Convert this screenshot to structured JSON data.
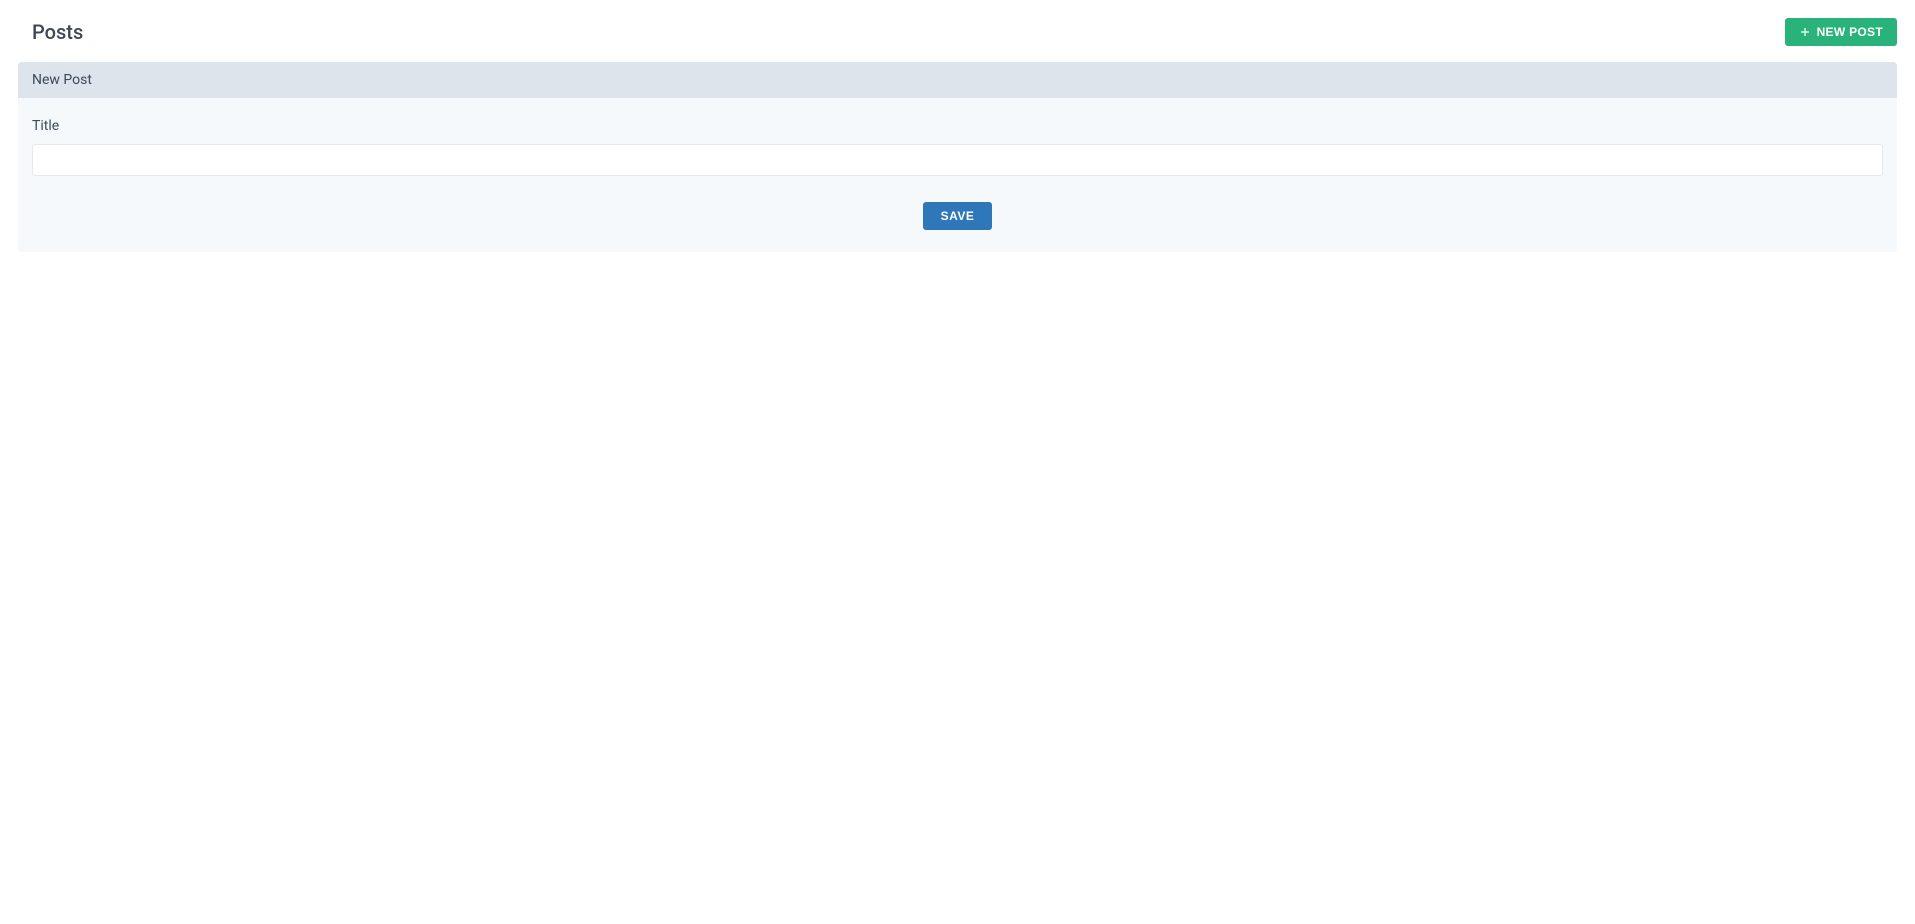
{
  "header": {
    "title": "Posts",
    "new_post_button_label": "NEW POST"
  },
  "card": {
    "header_label": "New Post",
    "form": {
      "title_label": "Title",
      "title_value": "",
      "title_placeholder": ""
    },
    "save_button_label": "SAVE"
  }
}
